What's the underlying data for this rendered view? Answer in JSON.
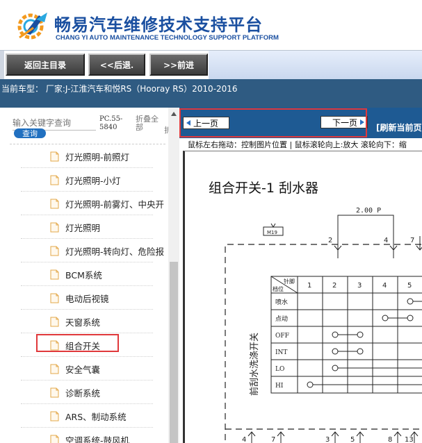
{
  "header": {
    "title_cn": "畅易汽车维修技术支持平台",
    "title_en": "CHANG YI AUTO MAINTENANCE TECHNOLOGY SUPPORT PLATFORM",
    "brand_color": "#1a4fa0",
    "logo_icon": "gear-rocket-logo-icon"
  },
  "toolbar": {
    "home_label": "返回主目录",
    "back_label": "<<后退.",
    "forward_label": ">>前进"
  },
  "car": {
    "label": "当前车型：",
    "value": "厂家:J-江淮汽车和悦RS（Hooray RS）2010-2016"
  },
  "sidebar": {
    "search_placeholder": "输入关键字查询",
    "search_button": "查询",
    "pc_code": "PC.55-5840",
    "fold_all": "折叠全部",
    "fold_extra": "折",
    "items": [
      {
        "label": "灯光照明-前照灯"
      },
      {
        "label": "灯光照明-小灯"
      },
      {
        "label": "灯光照明-前雾灯、中央开"
      },
      {
        "label": "灯光照明"
      },
      {
        "label": "灯光照明-转向灯、危险报"
      },
      {
        "label": "BCM系统"
      },
      {
        "label": "电动后视镜"
      },
      {
        "label": "天窗系统"
      },
      {
        "label": "组合开关"
      },
      {
        "label": "安全气囊"
      },
      {
        "label": "诊断系统"
      },
      {
        "label": "ARS、制动系统"
      },
      {
        "label": "空调系统-鼓风机"
      }
    ],
    "selected_index": 8
  },
  "viewer": {
    "prev_label": "上一页",
    "next_label": "下一页",
    "refresh_label": "[刷新当前页",
    "hint": "鼠标左右拖动：控制图片位置 | 鼠标滚轮向上:放大  滚轮向下：缩",
    "accent_color": "#1e5a93",
    "highlight_color": "#e0383b"
  },
  "diagram": {
    "title": "组合开关-1   刮水器",
    "dimension_label": "2.00 P",
    "connector_label": "M19",
    "vertical_label": "前刮水洗涤开关",
    "header_pin": "针脚",
    "header_pos": "档位",
    "pins": [
      "1",
      "2",
      "3",
      "4",
      "5"
    ],
    "rows": [
      "喷水",
      "点动",
      "OFF",
      "INT",
      "LO",
      "HI"
    ],
    "top_terminals": [
      "2",
      "4",
      "7"
    ],
    "bottom_terminals": [
      "4",
      "7",
      "3",
      "5",
      "8",
      "13"
    ]
  }
}
